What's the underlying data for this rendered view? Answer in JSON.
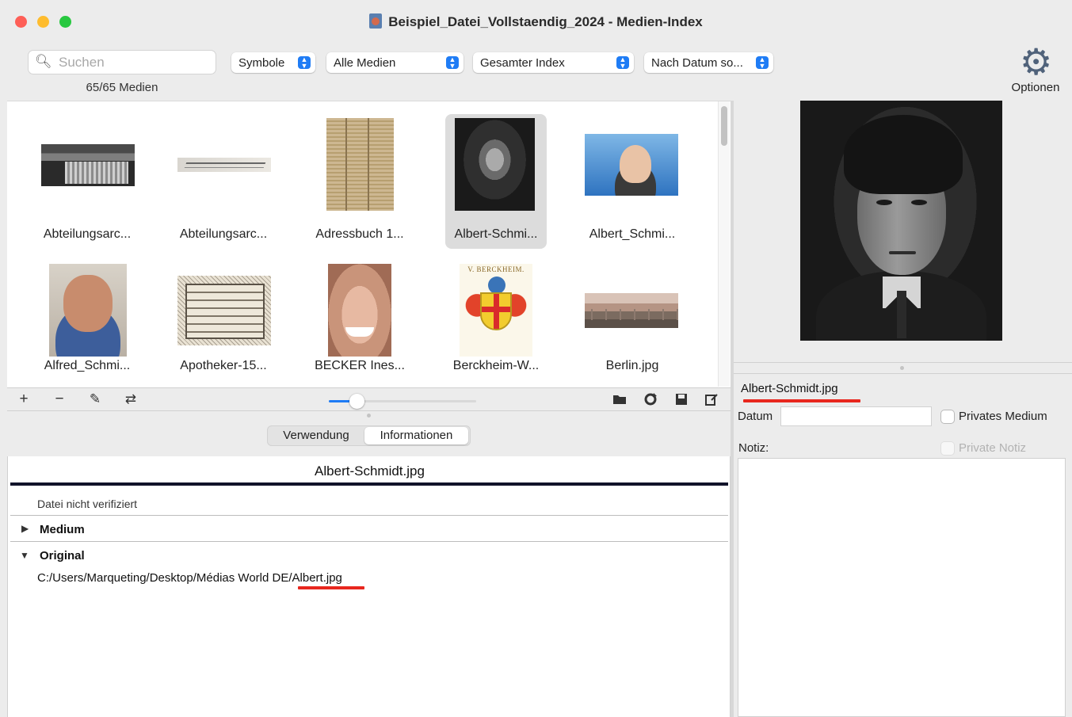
{
  "window": {
    "title": "Beispiel_Datei_Vollstaendig_2024 - Medien-Index"
  },
  "toolbar": {
    "search_placeholder": "Suchen",
    "media_count": "65/65 Medien",
    "view_popup": "Symbole",
    "filter_popup": "Alle Medien",
    "scope_popup": "Gesamter Index",
    "sort_popup": "Nach Datum so...",
    "options_label": "Optionen"
  },
  "media_grid": {
    "items": [
      {
        "label": "Abteilungsarc...",
        "icon": "document-scan-thumbnail",
        "selected": false
      },
      {
        "label": "Abteilungsarc...",
        "icon": "handwriting-thumbnail",
        "selected": false
      },
      {
        "label": "Adressbuch 1...",
        "icon": "ledger-page-thumbnail",
        "selected": false
      },
      {
        "label": "Albert-Schmi...",
        "icon": "portrait-thumbnail",
        "selected": true
      },
      {
        "label": "Albert_Schmi...",
        "icon": "photo-thumbnail",
        "selected": false
      },
      {
        "label": "Alfred_Schmi...",
        "icon": "portrait-thumbnail",
        "selected": false
      },
      {
        "label": "Apotheker-15...",
        "icon": "engraving-thumbnail",
        "selected": false
      },
      {
        "label": "BECKER Ines...",
        "icon": "face-photo-thumbnail",
        "selected": false
      },
      {
        "label": "Berckheim-W...",
        "icon": "coat-of-arms-thumbnail",
        "selected": false
      },
      {
        "label": "Berlin.jpg",
        "icon": "city-photo-thumbnail",
        "selected": false
      }
    ],
    "crest_caption": "V. BERCKHEIM.",
    "thumbnail_size_fraction": 0.19
  },
  "grid_actions": {
    "add": "+",
    "remove": "−",
    "edit": "✎",
    "merge": "⇄"
  },
  "tabs": {
    "usage": "Verwendung",
    "information": "Informationen",
    "active": "information"
  },
  "info": {
    "filename": "Albert-Schmidt.jpg",
    "status": "Datei nicht verifiziert",
    "section_medium": "Medium",
    "section_original": "Original",
    "path_prefix": "C:/Users/Marqueting/Desktop/Médias World DE/",
    "path_file": "Albert.jpg"
  },
  "details": {
    "filename": "Albert-Schmidt.jpg",
    "date_label": "Datum",
    "date_value": "",
    "private_media_label": "Privates Medium",
    "note_label": "Notiz:",
    "private_note_label": "Private Notiz",
    "note_value": ""
  },
  "colors": {
    "accent": "#1f7cf5",
    "highlight_underline": "#e8271e",
    "selection": "#dcdcdc"
  }
}
